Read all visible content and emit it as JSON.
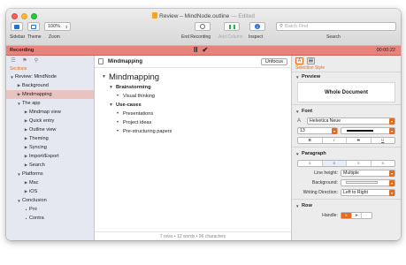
{
  "window": {
    "title": "Review – MindNode.outline",
    "edited": "— Edited"
  },
  "toolbar": {
    "sidebar_label": "Sidebar",
    "theme_label": "Theme",
    "zoom_value": "100%",
    "zoom_label": "Zoom",
    "end_recording_label": "End Recording",
    "add_column_label": "Add Column",
    "inspect_label": "Inspect",
    "search_placeholder": "Batch Find",
    "search_label": "Search"
  },
  "recording": {
    "label": "Recording",
    "pause": "II",
    "done": "✔",
    "time": "00:00:22"
  },
  "sidebar": {
    "heading": "Sections",
    "items": [
      {
        "label": "Review: MindNode",
        "level": 0,
        "arrow": "▼",
        "selected": false
      },
      {
        "label": "Background",
        "level": 1,
        "arrow": "▶",
        "selected": false
      },
      {
        "label": "Mindmapping",
        "level": 1,
        "arrow": "▶",
        "selected": true
      },
      {
        "label": "The app",
        "level": 1,
        "arrow": "▼",
        "selected": false
      },
      {
        "label": "Mindmap view",
        "level": 2,
        "arrow": "▶",
        "selected": false
      },
      {
        "label": "Quick entry",
        "level": 2,
        "arrow": "▶",
        "selected": false
      },
      {
        "label": "Outline view",
        "level": 2,
        "arrow": "▶",
        "selected": false
      },
      {
        "label": "Theming",
        "level": 2,
        "arrow": "▶",
        "selected": false
      },
      {
        "label": "Syncing",
        "level": 2,
        "arrow": "▶",
        "selected": false
      },
      {
        "label": "Import/Export",
        "level": 2,
        "arrow": "▶",
        "selected": false
      },
      {
        "label": "Search",
        "level": 2,
        "arrow": "▶",
        "selected": false
      },
      {
        "label": "Platforms",
        "level": 1,
        "arrow": "▼",
        "selected": false
      },
      {
        "label": "Mac",
        "level": 2,
        "arrow": "▶",
        "selected": false
      },
      {
        "label": "iOS",
        "level": 2,
        "arrow": "▶",
        "selected": false
      },
      {
        "label": "Conclusion",
        "level": 1,
        "arrow": "▼",
        "selected": false
      },
      {
        "label": "Pro",
        "level": 2,
        "arrow": "•",
        "selected": false
      },
      {
        "label": "Contra",
        "level": 2,
        "arrow": "•",
        "selected": false
      }
    ]
  },
  "editor": {
    "title": "Mindmapping",
    "unfocus_label": "Unfocus",
    "heading": "Mindmapping",
    "sections": [
      {
        "label": "Brainstorming",
        "children": [
          "Visual thinking"
        ]
      },
      {
        "label": "Use-cases",
        "children": [
          "Presentations",
          "Project ideas",
          "Pre-structuring papers"
        ]
      }
    ],
    "footer": "7 rows • 12 words • 96 characters"
  },
  "inspector": {
    "sub_label": "Selection Style",
    "preview_heading": "Preview",
    "preview_text": "Whole Document",
    "font_heading": "Font",
    "font_name": "Helvetica Neue",
    "font_size": "13",
    "paragraph_heading": "Paragraph",
    "line_height_label": "Line height:",
    "line_height_value": "Multiple",
    "background_label": "Background:",
    "writing_direction_label": "Writing Direction:",
    "writing_direction_value": "Left to Right",
    "row_heading": "Row",
    "handle_label": "Handle:"
  },
  "colors": {
    "accent": "#e86a1a",
    "recording_bar": "#e8827c",
    "selected_row": "#e9c3c0"
  }
}
